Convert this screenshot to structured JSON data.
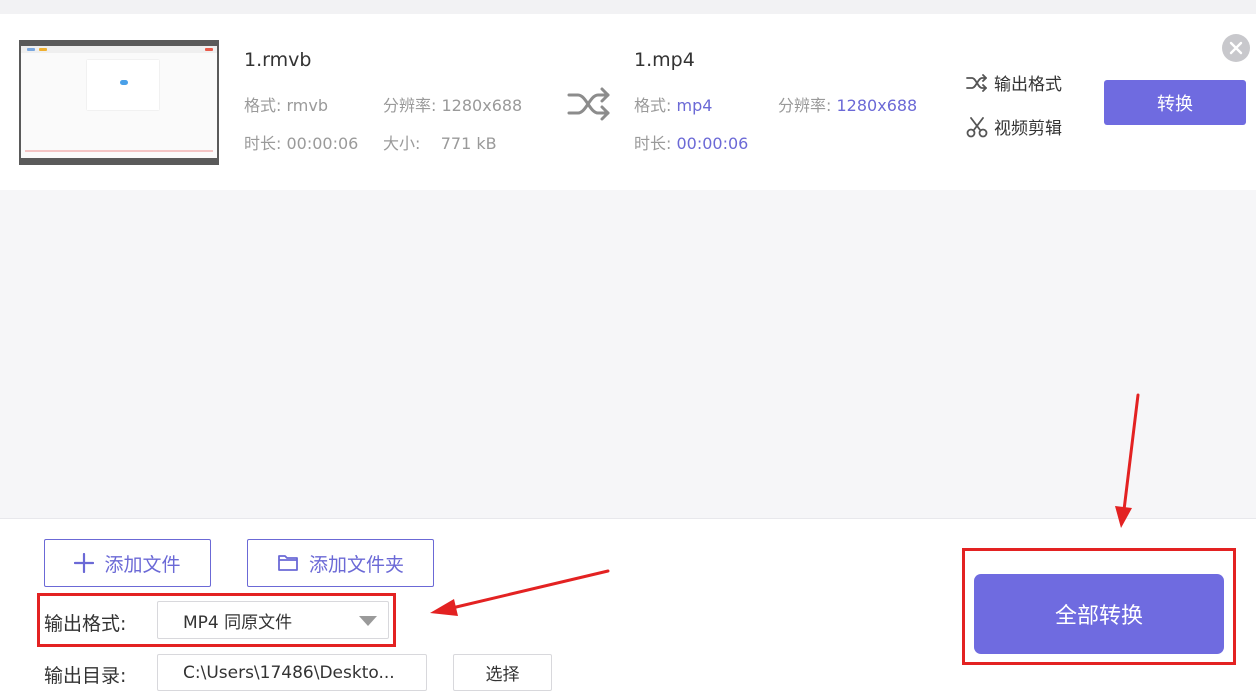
{
  "file": {
    "source": {
      "name": "1.rmvb",
      "format_label": "格式:",
      "format": "rmvb",
      "resolution_label": "分辨率:",
      "resolution": "1280x688",
      "duration_label": "时长:",
      "duration": "00:00:06",
      "size_label": "大小:",
      "size": "771 kB"
    },
    "target": {
      "name": "1.mp4",
      "format_label": "格式:",
      "format": "mp4",
      "resolution_label": "分辨率:",
      "resolution": "1280x688",
      "duration_label": "时长:",
      "duration": "00:00:06"
    },
    "actions": {
      "output_format": "输出格式",
      "video_edit": "视频剪辑",
      "convert": "转换"
    }
  },
  "bottom": {
    "add_file": "添加文件",
    "add_folder": "添加文件夹",
    "output_format_label": "输出格式:",
    "output_format_value": "MP4 同原文件",
    "output_dir_label": "输出目录:",
    "output_dir_value": "C:\\Users\\17486\\Deskto...",
    "choose": "选择",
    "convert_all": "全部转换"
  },
  "colors": {
    "accent": "#6f6be0",
    "highlight_text": "#6b69d6",
    "annotation_red": "#e32222"
  },
  "icons": [
    "shuffle-icon",
    "close-icon",
    "scissors-icon",
    "plus-icon",
    "folder-icon",
    "chevron-down-icon"
  ]
}
